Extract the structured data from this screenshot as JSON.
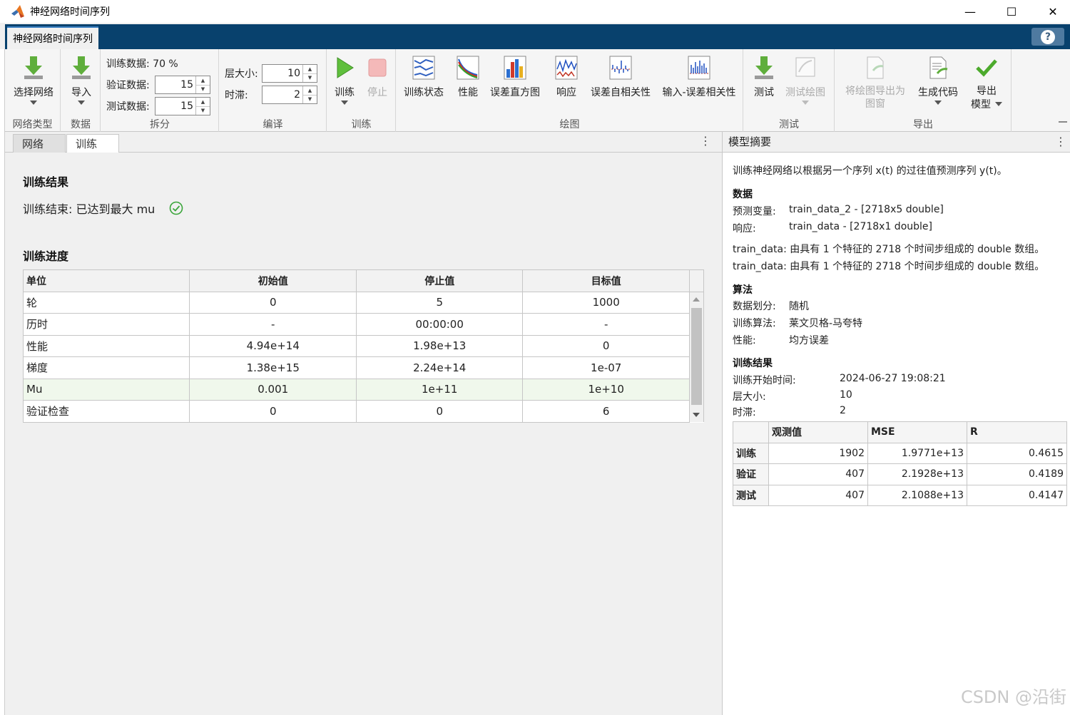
{
  "window": {
    "title": "神经网络时间序列",
    "minimize": "—",
    "maximize": "☐",
    "close": "✕"
  },
  "app_tab": "神经网络时间序列",
  "help": "?",
  "toolstrip": {
    "net_type": {
      "button": "选择网络",
      "label": "网络类型"
    },
    "data": {
      "button": "导入",
      "label": "数据"
    },
    "split": {
      "label": "拆分",
      "train_text": "训练数据: 70 %",
      "val_label": "验证数据:",
      "val_value": "15",
      "test_label": "测试数据:",
      "test_value": "15"
    },
    "compile": {
      "label": "编译",
      "layer_label": "层大小:",
      "layer_value": "10",
      "delay_label": "时滞:",
      "delay_value": "2"
    },
    "train": {
      "label": "训练",
      "train_button": "训练",
      "stop_button": "停止"
    },
    "plots": {
      "label": "绘图",
      "buttons": [
        "训练状态",
        "性能",
        "误差直方图",
        "响应",
        "误差自相关性",
        "输入-误差相关性"
      ]
    },
    "test": {
      "label": "测试",
      "test_button": "测试",
      "test_plot_button": "测试绘图"
    },
    "export": {
      "label": "导出",
      "export_fig": "将绘图导出为",
      "export_fig2": "图窗",
      "gen_code": "生成代码",
      "export_model": "导出",
      "export_model2": "模型"
    }
  },
  "doc_tabs": [
    "网络",
    "训练"
  ],
  "train_panel": {
    "result_heading": "训练结果",
    "result_text": "训练结束: 已达到最大 mu",
    "progress_heading": "训练进度",
    "table_headers": [
      "单位",
      "初始值",
      "停止值",
      "目标值"
    ],
    "rows": [
      [
        "轮",
        "0",
        "5",
        "1000"
      ],
      [
        "历时",
        "-",
        "00:00:00",
        "-"
      ],
      [
        "性能",
        "4.94e+14",
        "1.98e+13",
        "0"
      ],
      [
        "梯度",
        "1.38e+15",
        "2.24e+14",
        "1e-07"
      ],
      [
        "Mu",
        "0.001",
        "1e+11",
        "1e+10"
      ],
      [
        "验证检查",
        "0",
        "0",
        "6"
      ]
    ]
  },
  "summary": {
    "title": "模型摘要",
    "intro": "训练神经网络以根据另一个序列 x(t) 的过往值预测序列 y(t)。",
    "data_heading": "数据",
    "predictor_label": "预测变量:",
    "predictor_value": "train_data_2 - [2718x5 double]",
    "response_label": "响应:",
    "response_value": "train_data - [2718x1 double]",
    "note1": "train_data: 由具有 1 个特征的 2718 个时间步组成的 double 数组。",
    "note2": "train_data: 由具有 1 个特征的 2718 个时间步组成的 double 数组。",
    "algo_heading": "算法",
    "split_label": "数据划分:",
    "split_value": "随机",
    "algo_label": "训练算法:",
    "algo_value": "莱文贝格-马夸特",
    "perf_label": "性能:",
    "perf_value": "均方误差",
    "result_heading": "训练结果",
    "start_label": "训练开始时间:",
    "start_value": "2024-06-27 19:08:21",
    "layer_label": "层大小:",
    "layer_value": "10",
    "delay_label": "时滞:",
    "delay_value": "2",
    "metric_headers": [
      "",
      "观测值",
      "MSE",
      "R"
    ],
    "metric_rows": [
      [
        "训练",
        "1902",
        "1.9771e+13",
        "0.4615"
      ],
      [
        "验证",
        "407",
        "2.1928e+13",
        "0.4189"
      ],
      [
        "测试",
        "407",
        "2.1088e+13",
        "0.4147"
      ]
    ]
  },
  "watermark": "CSDN @沿街"
}
